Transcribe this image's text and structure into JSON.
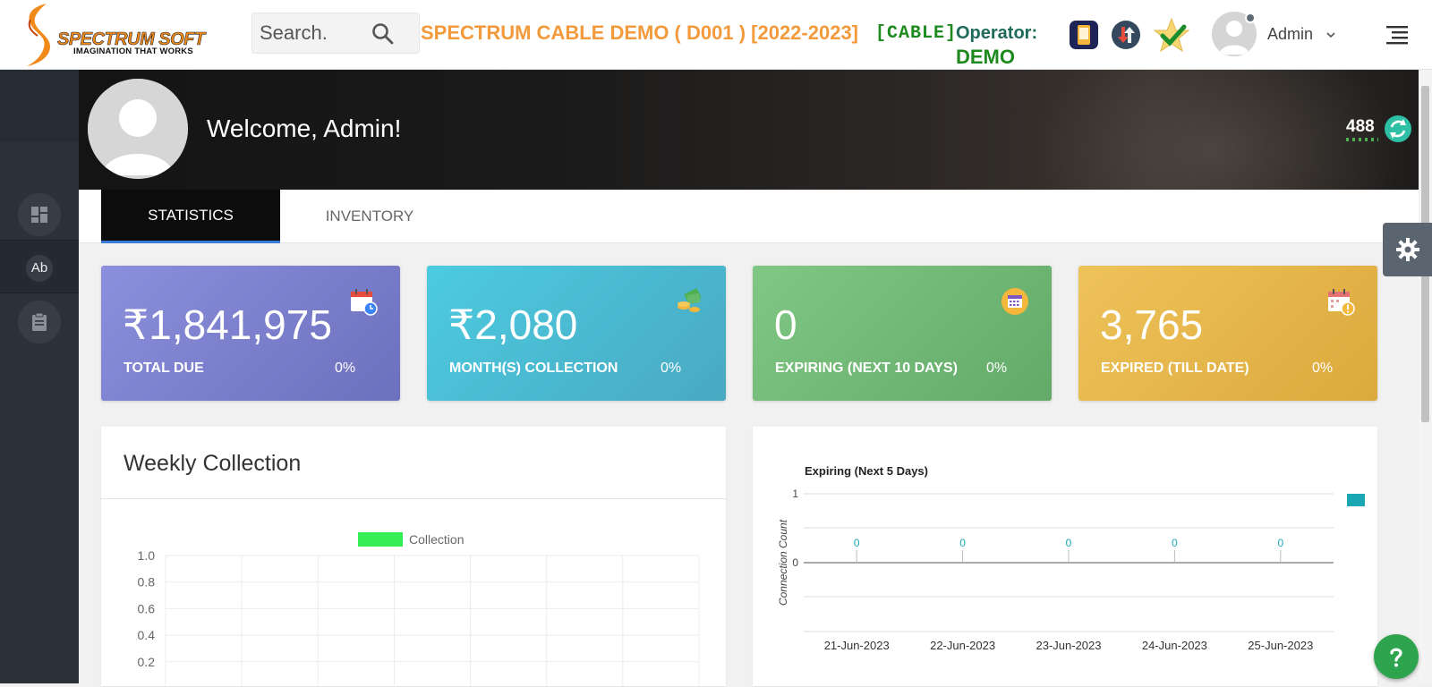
{
  "header": {
    "brand": "SPECTRUM SOFT",
    "tagline": "IMAGINATION THAT WORKS",
    "search_placeholder": "Search.",
    "company": "SPECTRUM CABLE DEMO ( D001 ) [2022-2023]",
    "service_tag": "[CABLE]",
    "operator_label": "Operator:",
    "operator_value": "DEMO",
    "user_name": "Admin",
    "icons": [
      "app-icon",
      "download-upload-icon",
      "verified-star-icon",
      "user-avatar-icon",
      "chevron-down-icon",
      "menu-icon"
    ]
  },
  "sidebar": {
    "items": [
      {
        "icon": "dashboard-icon"
      },
      {
        "label": "Ab"
      },
      {
        "icon": "clipboard-icon"
      }
    ]
  },
  "banner": {
    "welcome": "Welcome, Admin!",
    "count": "488"
  },
  "tabs": [
    {
      "label": "STATISTICS",
      "active": true
    },
    {
      "label": "INVENTORY",
      "active": false
    }
  ],
  "cards": [
    {
      "value": "₹1,841,975",
      "label": "TOTAL DUE",
      "percent": "0%",
      "color": "#7c80cd",
      "icon": "calendar-clock-icon"
    },
    {
      "value": "₹2,080",
      "label": "MONTH(S) COLLECTION",
      "percent": "0%",
      "color": "#4bbcd3",
      "icon": "money-coins-icon"
    },
    {
      "value": "0",
      "label": "EXPIRING (NEXT 10 DAYS)",
      "percent": "0%",
      "color": "#72b977",
      "icon": "calendar-badge-icon"
    },
    {
      "value": "3,765",
      "label": "EXPIRED (TILL DATE)",
      "percent": "0%",
      "color": "#e5b64a",
      "icon": "calendar-warning-icon"
    }
  ],
  "weekly_panel": {
    "title": "Weekly Collection"
  },
  "chart_data": [
    {
      "type": "bar",
      "title": "",
      "legend": [
        "Collection"
      ],
      "series": [
        {
          "name": "Collection",
          "color": "#33ee55",
          "values": []
        }
      ],
      "yticks": [
        "1.0",
        "0.8",
        "0.6",
        "0.4",
        "0.2"
      ],
      "ylim": [
        0,
        1.0
      ],
      "grid": true,
      "legend_position": "top"
    },
    {
      "type": "bar",
      "title": "Expiring (Next 5 Days)",
      "ylabel": "Connection Count",
      "categories": [
        "21-Jun-2023",
        "22-Jun-2023",
        "23-Jun-2023",
        "24-Jun-2023",
        "25-Jun-2023"
      ],
      "values": [
        0,
        0,
        0,
        0,
        0
      ],
      "data_labels": [
        "0",
        "0",
        "0",
        "0",
        "0"
      ],
      "yticks": [
        "1",
        "0"
      ],
      "series_color": "#1ba7b3",
      "grid": true,
      "legend_position": "right"
    }
  ],
  "widgets": {
    "settings_icon": "gear-icon",
    "help_icon": "help-icon"
  }
}
